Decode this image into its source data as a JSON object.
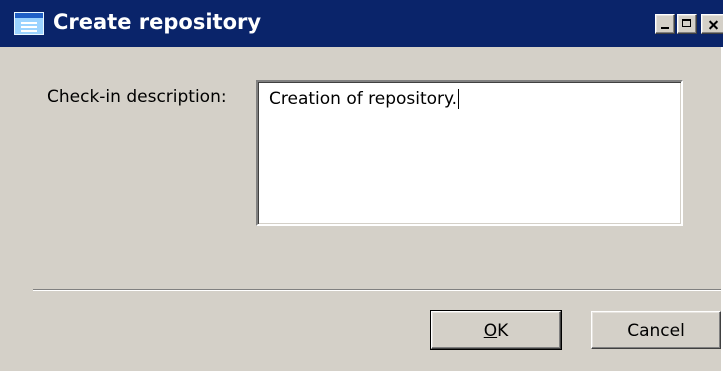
{
  "window": {
    "title": "Create repository"
  },
  "form": {
    "description_label": "Check-in description:",
    "description_value": "Creation of repository."
  },
  "buttons": {
    "ok_access_key": "O",
    "ok_rest": "K",
    "cancel_label": "Cancel"
  },
  "colors": {
    "title_bar": "#0a246a",
    "dialog_face": "#d4d0c8"
  },
  "icons": {
    "app": "dialog-window-icon",
    "minimize": "minimize-icon",
    "maximize": "maximize-icon",
    "close": "close-icon"
  }
}
